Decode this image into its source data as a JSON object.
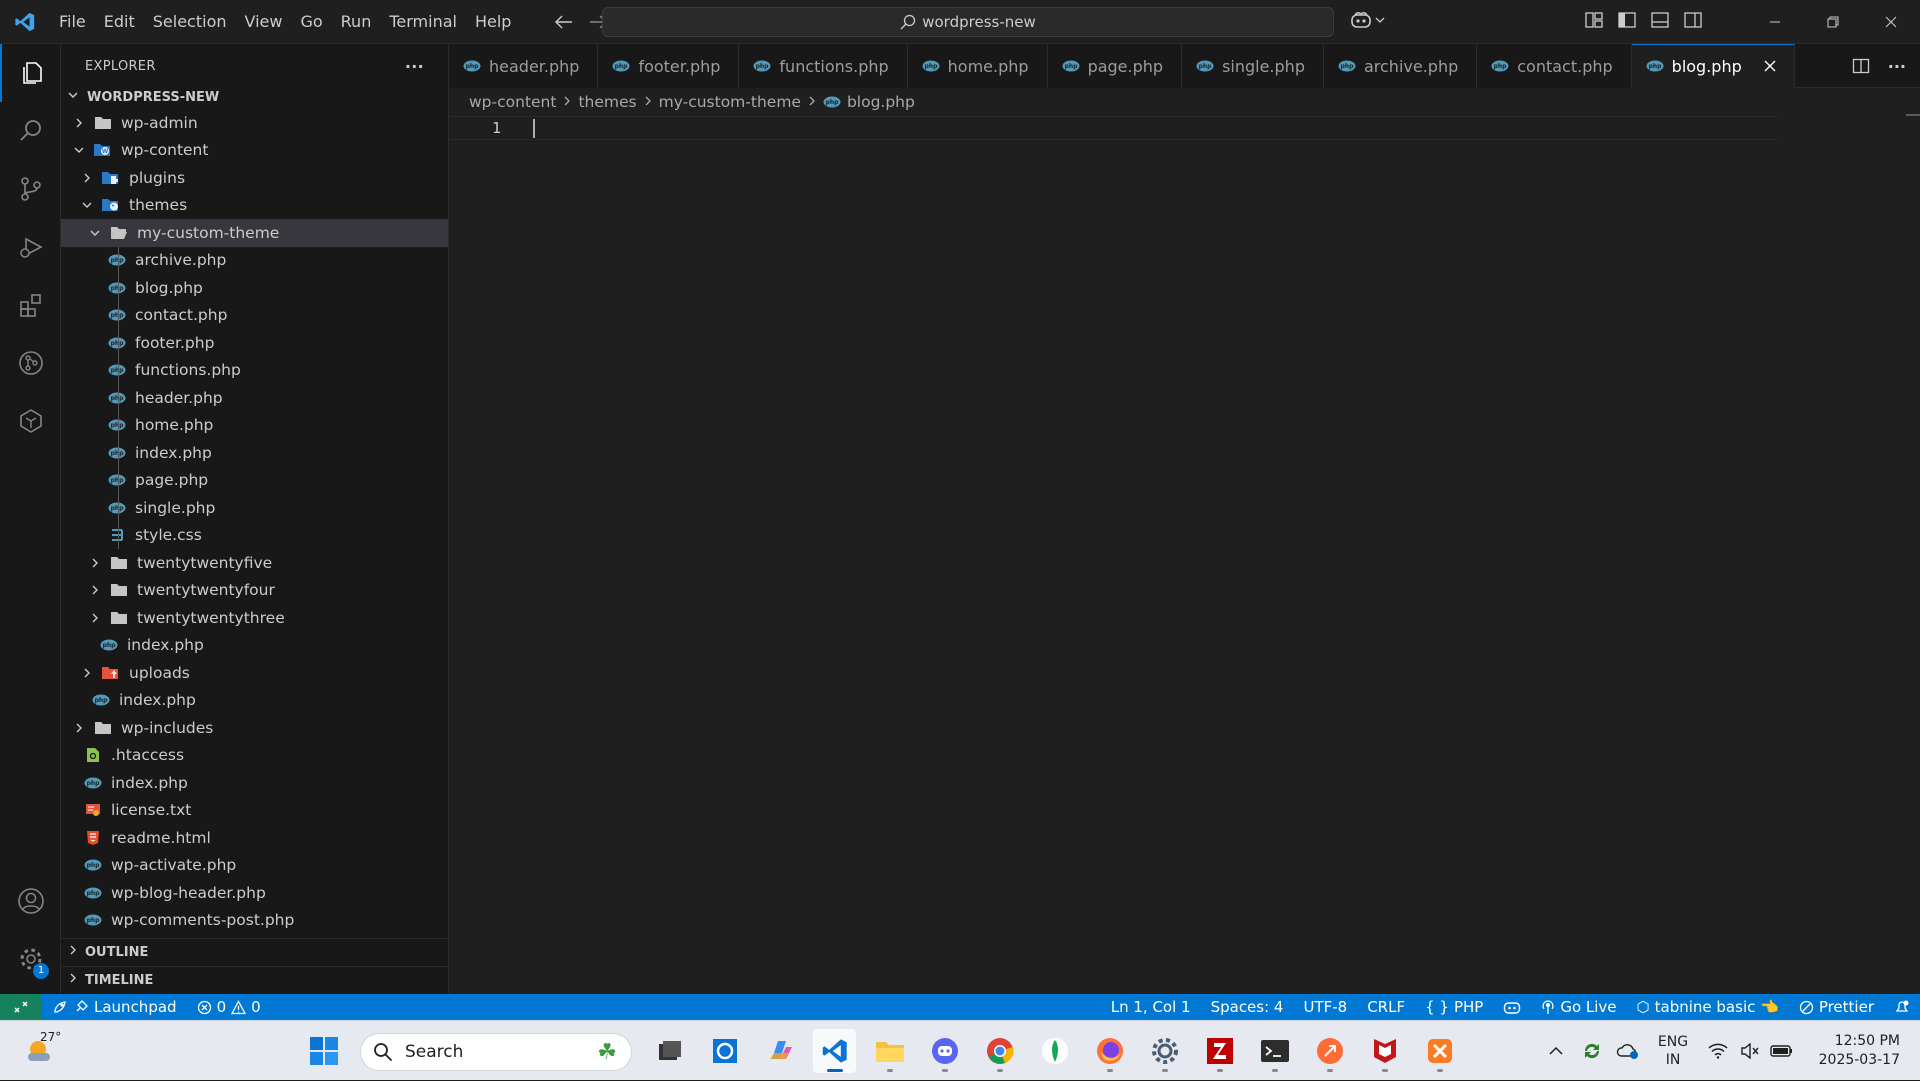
{
  "titlebar": {
    "menu": [
      "File",
      "Edit",
      "Selection",
      "View",
      "Go",
      "Run",
      "Terminal",
      "Help"
    ],
    "search_text": "wordpress-new"
  },
  "sidebar": {
    "title": "EXPLORER",
    "more": "···",
    "root": "WORDPRESS-NEW",
    "items": [
      {
        "label": "wp-admin",
        "icon": "folder-icon"
      },
      {
        "label": "wp-content",
        "icon": "wordpress-folder-icon"
      },
      {
        "label": "plugins",
        "icon": "plugins-folder-icon"
      },
      {
        "label": "themes",
        "icon": "themes-folder-icon"
      },
      {
        "label": "my-custom-theme",
        "icon": "folder-open-icon"
      },
      {
        "label": "archive.php",
        "icon": "php-icon"
      },
      {
        "label": "blog.php",
        "icon": "php-icon"
      },
      {
        "label": "contact.php",
        "icon": "php-icon"
      },
      {
        "label": "footer.php",
        "icon": "php-icon"
      },
      {
        "label": "functions.php",
        "icon": "php-icon"
      },
      {
        "label": "header.php",
        "icon": "php-icon"
      },
      {
        "label": "home.php",
        "icon": "php-icon"
      },
      {
        "label": "index.php",
        "icon": "php-icon"
      },
      {
        "label": "page.php",
        "icon": "php-icon"
      },
      {
        "label": "single.php",
        "icon": "php-icon"
      },
      {
        "label": "style.css",
        "icon": "css-icon"
      },
      {
        "label": "twentytwentyfive",
        "icon": "folder-icon"
      },
      {
        "label": "twentytwentyfour",
        "icon": "folder-icon"
      },
      {
        "label": "twentytwentythree",
        "icon": "folder-icon"
      },
      {
        "label": "index.php",
        "icon": "php-icon"
      },
      {
        "label": "uploads",
        "icon": "uploads-folder-icon"
      },
      {
        "label": "index.php",
        "icon": "php-icon"
      },
      {
        "label": "wp-includes",
        "icon": "folder-icon"
      },
      {
        "label": ".htaccess",
        "icon": "htaccess-icon"
      },
      {
        "label": "index.php",
        "icon": "php-icon"
      },
      {
        "label": "license.txt",
        "icon": "license-icon"
      },
      {
        "label": "readme.html",
        "icon": "html-icon"
      },
      {
        "label": "wp-activate.php",
        "icon": "php-icon"
      },
      {
        "label": "wp-blog-header.php",
        "icon": "php-icon"
      },
      {
        "label": "wp-comments-post.php",
        "icon": "php-icon"
      }
    ],
    "outline": "OUTLINE",
    "timeline": "TIMELINE"
  },
  "activitybar": {
    "settings_badge": "1"
  },
  "editor": {
    "tabs": [
      "header.php",
      "footer.php",
      "functions.php",
      "home.php",
      "page.php",
      "single.php",
      "archive.php",
      "contact.php",
      "blog.php"
    ],
    "active_tab": "blog.php",
    "breadcrumbs": [
      "wp-content",
      "themes",
      "my-custom-theme",
      "blog.php"
    ],
    "line_number": "1"
  },
  "statusbar": {
    "launchpad": "Launchpad",
    "errors": "0",
    "warnings": "0",
    "position": "Ln 1, Col 1",
    "spaces": "Spaces: 4",
    "encoding": "UTF-8",
    "eol": "CRLF",
    "language": "PHP",
    "golive": "Go Live",
    "tabnine": "tabnine basic 👈",
    "prettier": "Prettier"
  },
  "taskbar": {
    "temperature": "27°",
    "search_placeholder": "Search",
    "lang_line1": "ENG",
    "lang_line2": "IN",
    "time": "12:50 PM",
    "date": "2025-03-17"
  },
  "colors": {
    "accent": "#0078d4",
    "statusbar": "#0078d4",
    "remote": "#16825d",
    "php": "#519aba"
  }
}
